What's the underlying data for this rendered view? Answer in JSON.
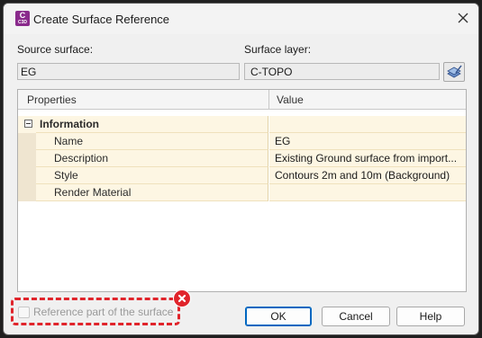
{
  "window": {
    "title": "Create Surface Reference",
    "app_icon_letter": "C",
    "app_icon_sub": "C3D"
  },
  "source": {
    "label": "Source surface:",
    "value": "EG"
  },
  "layer": {
    "label": "Surface layer:",
    "value": "C-TOPO"
  },
  "grid": {
    "col_properties": "Properties",
    "col_value": "Value",
    "group": "Information",
    "rows": [
      {
        "name": "Name",
        "value": "EG"
      },
      {
        "name": "Description",
        "value": "Existing Ground surface from import..."
      },
      {
        "name": "Style",
        "value": "Contours 2m and 10m (Background)"
      },
      {
        "name": "Render Material",
        "value": ""
      }
    ]
  },
  "options": {
    "reference_part_label": "Reference part of the surface",
    "reference_part_checked": false
  },
  "buttons": {
    "ok": "OK",
    "cancel": "Cancel",
    "help": "Help"
  },
  "colors": {
    "annotation_red": "#e0242b",
    "accent": "#0067c0",
    "app_icon": "#8a2a8c"
  }
}
